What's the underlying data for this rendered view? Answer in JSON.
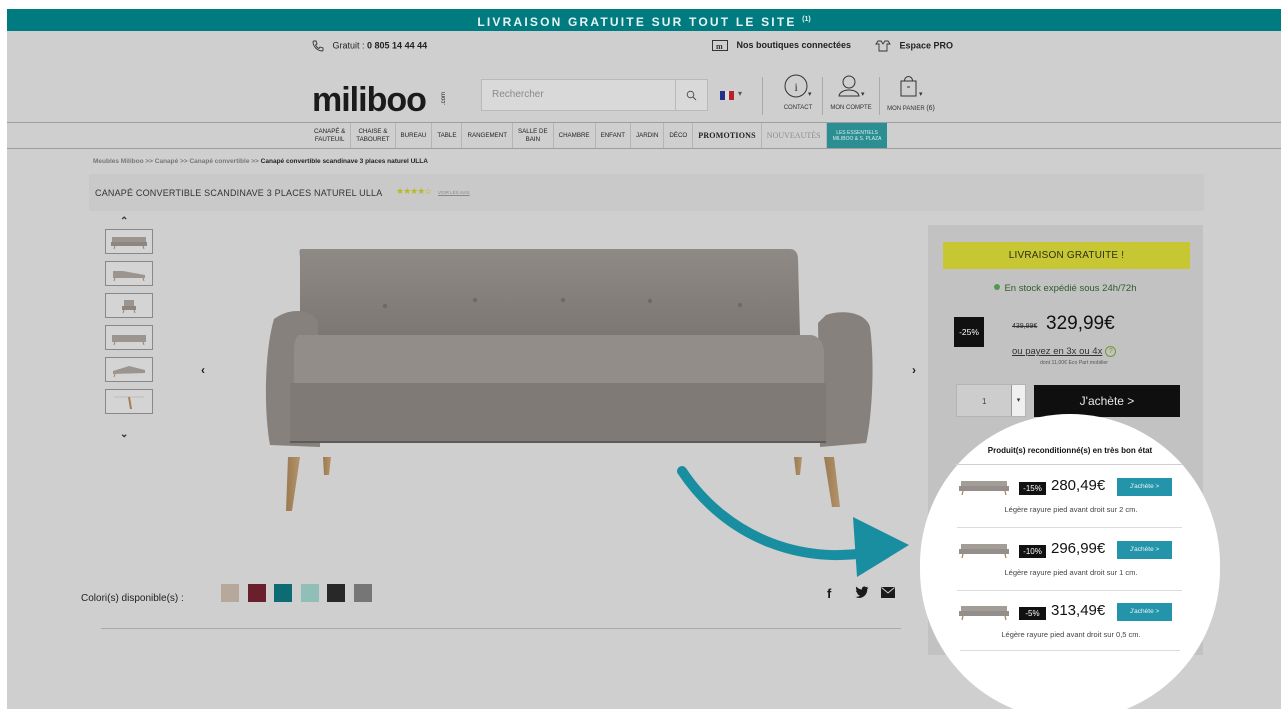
{
  "banner": {
    "text": "LIVRAISON GRATUITE SUR TOUT LE SITE",
    "note": "(1)"
  },
  "inforow": {
    "phone_prefix": "Gratuit : ",
    "phone_number": "0 805 14 44 44",
    "stores": "Nos boutiques connectées",
    "pro": "Espace PRO"
  },
  "header": {
    "logo": "miliboo",
    "logo_suffix": ".com",
    "search_placeholder": "Rechercher",
    "contact": "CONTACT",
    "account": "MON COMPTE",
    "cart": "MON PANIER",
    "cart_count": "(6)"
  },
  "nav": [
    {
      "line1": "CANAPÉ &",
      "line2": "FAUTEUIL"
    },
    {
      "line1": "CHAISE &",
      "line2": "TABOURET"
    },
    {
      "line1": "BUREAU",
      "line2": ""
    },
    {
      "line1": "TABLE",
      "line2": ""
    },
    {
      "line1": "RANGEMENT",
      "line2": ""
    },
    {
      "line1": "SALLE DE",
      "line2": "BAIN"
    },
    {
      "line1": "CHAMBRE",
      "line2": ""
    },
    {
      "line1": "ENFANT",
      "line2": ""
    },
    {
      "line1": "JARDIN",
      "line2": ""
    },
    {
      "line1": "DÉCO",
      "line2": ""
    }
  ],
  "nav_promo": "PROMOTIONS",
  "nav_news": "NOUVEAUTÉS",
  "nav_essentials": {
    "line1": "LES ESSENTIELS",
    "line2": "MILIBOO & S. PLAZA"
  },
  "breadcrumb": {
    "items": [
      "Meubles Miliboo",
      "Canapé",
      "Canapé convertible"
    ],
    "sep": ">>",
    "current": "Canapé convertible scandinave 3 places naturel ULLA"
  },
  "product": {
    "title": "CANAPÉ CONVERTIBLE SCANDINAVE 3 PLACES NATUREL ULLA",
    "rating_stars": 4,
    "reviews_link": "VOIR LES AVIS",
    "colors_label": "Colori(s) disponible(s) :",
    "colors": [
      "#d8c6b8",
      "#7d2434",
      "#0f7e87",
      "#a8e0d6",
      "#2f2f2f",
      "#8a8a8a"
    ],
    "colors_dimmed": [
      "#b7a89c",
      "#6a1f2c",
      "#0d6b73",
      "#8fbfb6",
      "#282828",
      "#767676"
    ]
  },
  "buybox": {
    "free_shipping": "LIVRAISON GRATUITE !",
    "stock": "En stock expédié sous 24h/72h",
    "discount": "-25%",
    "old_price": "439,99€",
    "price": "329,99€",
    "pay_installments": "ou payez en 3x ou 4x",
    "eco": "dont 11,00€ Eco Part mobilier",
    "quantity": "1",
    "buy_label": "J'achète >"
  },
  "refurb": {
    "title": "Produit(s) reconditionné(s) en très bon état",
    "items": [
      {
        "discount": "-15%",
        "price": "280,49€",
        "button": "J'achète >",
        "note": "Légère rayure pied avant droit sur 2 cm."
      },
      {
        "discount": "-10%",
        "price": "296,99€",
        "button": "J'achète >",
        "note": "Légère rayure pied avant droit sur 1 cm."
      },
      {
        "discount": "-5%",
        "price": "313,49€",
        "button": "J'achète >",
        "note": "Légère rayure pied avant droit sur 0,5 cm."
      }
    ]
  },
  "colors_theme": {
    "teal": "#007b7f",
    "accent_button": "#2394a9",
    "free_banner": "#c7c733",
    "arrow": "#1a8ea1"
  },
  "icons": [
    "phone-icon",
    "store-icon",
    "pro-icon",
    "search-icon",
    "flag-fr-icon",
    "info-icon",
    "user-icon",
    "bag-icon",
    "facebook-icon",
    "twitter-icon",
    "mail-icon"
  ]
}
